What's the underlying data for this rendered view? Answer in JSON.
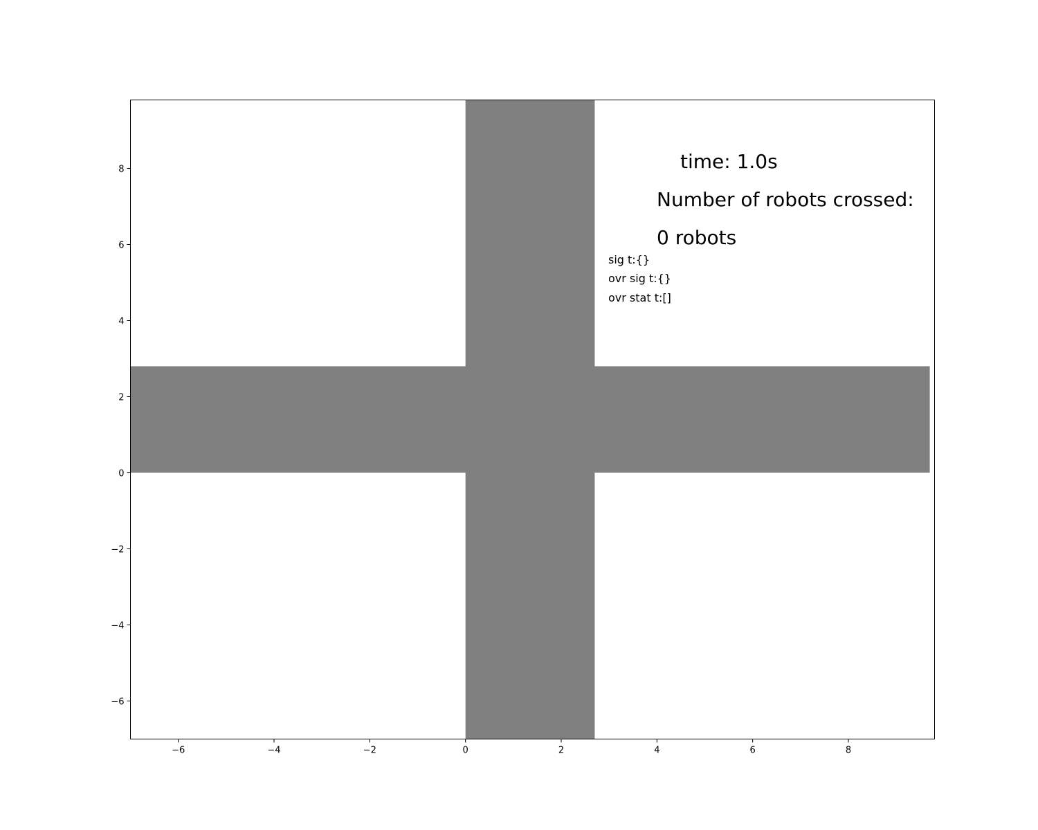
{
  "chart_data": {
    "type": "other",
    "xlim": [
      -7.0,
      9.8
    ],
    "ylim": [
      -7.0,
      9.8
    ],
    "xticks": [
      -6,
      -4,
      -2,
      0,
      2,
      4,
      6,
      8
    ],
    "yticks": [
      -6,
      -4,
      -2,
      0,
      2,
      4,
      6,
      8
    ],
    "xtick_labels": [
      "−6",
      "−4",
      "−2",
      "0",
      "2",
      "4",
      "6",
      "8"
    ],
    "ytick_labels": [
      "−6",
      "−4",
      "−2",
      "0",
      "2",
      "4",
      "6",
      "8"
    ],
    "grid": false,
    "road_color": "#808080",
    "roads": [
      {
        "x": [
          0,
          2.7
        ],
        "y": [
          -7.0,
          9.8
        ]
      },
      {
        "x": [
          -7.0,
          9.7
        ],
        "y": [
          0,
          2.8
        ]
      }
    ],
    "annotations": {
      "time": "time: 1.0s",
      "crossed_label": "Number of robots crossed:",
      "crossed_count": "0 robots",
      "sig": "sig t:{}",
      "ovr_sig": "ovr sig t:{}",
      "ovr_stat": "ovr stat t:[]"
    }
  }
}
